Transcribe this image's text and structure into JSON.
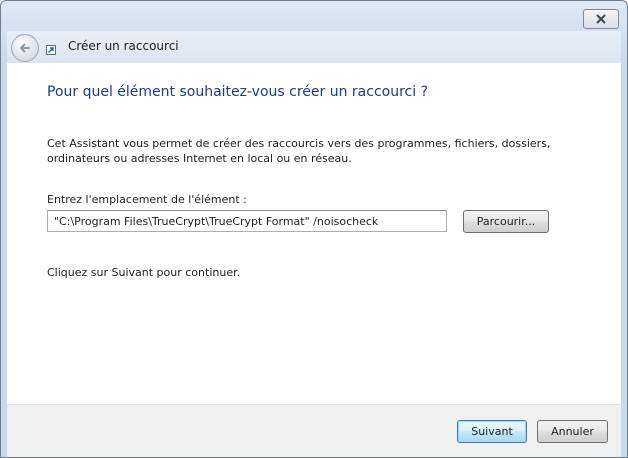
{
  "window": {
    "title": "Créer un raccourci"
  },
  "icons": {
    "close": "close-icon",
    "back": "back-arrow-icon",
    "shortcut": "shortcut-arrow-icon"
  },
  "content": {
    "heading": "Pour quel élément souhaitez-vous créer un raccourci ?",
    "description": "Cet Assistant vous permet de créer des raccourcis vers des programmes, fichiers, dossiers, ordinateurs ou adresses Internet en local ou en réseau.",
    "field_label": "Entrez l'emplacement de l'élément :",
    "location_value": "\"C:\\Program Files\\TrueCrypt\\TrueCrypt Format\" /noisocheck",
    "browse_label": "Parcourir...",
    "hint": "Cliquez sur Suivant pour continuer."
  },
  "footer": {
    "next_label": "Suivant",
    "cancel_label": "Annuler"
  },
  "colors": {
    "heading": "#1a3a90",
    "frame": "#cad9ea",
    "default_button_border": "#3c7fb1"
  }
}
